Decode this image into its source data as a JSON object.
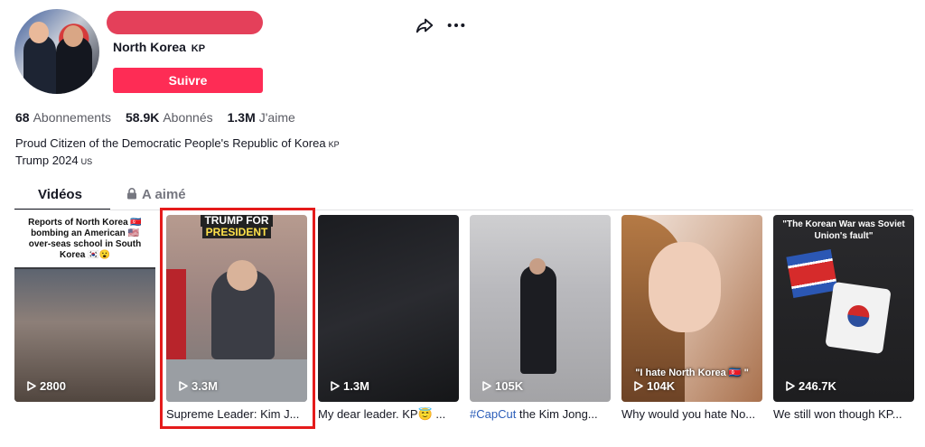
{
  "profile": {
    "nickname": "North Korea",
    "nickname_country": "KP",
    "follow_label": "Suivre"
  },
  "stats": [
    {
      "value": "68",
      "label": "Abonnements"
    },
    {
      "value": "58.9K",
      "label": "Abonnés"
    },
    {
      "value": "1.3M",
      "label": "J'aime"
    }
  ],
  "bio": {
    "line1": "Proud Citizen of the Democratic People's Republic of Korea",
    "line1_country": "KP",
    "line2": "Trump 2024",
    "line2_country": "US"
  },
  "tabs": {
    "videos": "Vidéos",
    "liked": "A aimé"
  },
  "colors": {
    "follow_button": "#fe2c55",
    "highlight_border": "#e51b1b"
  },
  "icons": {
    "share": "share-icon",
    "more": "more-icon",
    "lock": "lock-icon",
    "play": "play-icon"
  },
  "videos": [
    {
      "views": "2800",
      "overlay_text": "Reports of North Korea 🇰🇵 bombing an American 🇺🇸 over-seas school in South Korea 🇰🇷😮",
      "caption": ""
    },
    {
      "views": "3.3M",
      "overlay_line1": "TRUMP FOR",
      "overlay_line2": "PRESIDENT",
      "caption": "Supreme Leader: Kim J..."
    },
    {
      "views": "1.3M",
      "caption": "My dear leader. KP😇 ..."
    },
    {
      "views": "105K",
      "caption_tag": "#CapCut",
      "caption": " the Kim Jong..."
    },
    {
      "views": "104K",
      "overlay_text": "\"I hate North Korea 🇰🇵 \"",
      "caption": "Why would you hate No..."
    },
    {
      "views": "246.7K",
      "overlay_text": "\"The Korean War was Soviet Union's fault\"",
      "caption": "We still won though KP..."
    }
  ]
}
